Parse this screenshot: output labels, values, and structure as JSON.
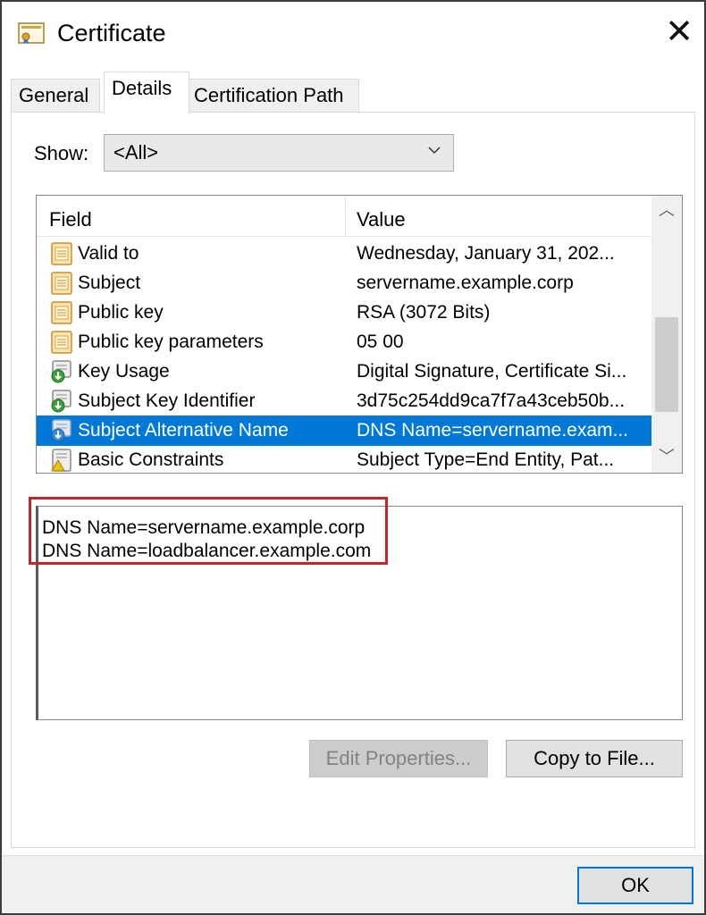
{
  "window": {
    "title": "Certificate",
    "close_glyph": "✕"
  },
  "tabs": [
    {
      "label": "General",
      "active": false
    },
    {
      "label": "Details",
      "active": true
    },
    {
      "label": "Certification Path",
      "active": false
    }
  ],
  "show": {
    "label": "Show:",
    "selected": "<All>"
  },
  "list": {
    "columns": {
      "field": "Field",
      "value": "Value"
    },
    "rows": [
      {
        "field": "Valid to",
        "value": "Wednesday, January 31, 202...",
        "icon": "document-icon",
        "selected": false
      },
      {
        "field": "Subject",
        "value": "servername.example.corp",
        "icon": "document-icon",
        "selected": false
      },
      {
        "field": "Public key",
        "value": "RSA (3072 Bits)",
        "icon": "document-icon",
        "selected": false
      },
      {
        "field": "Public key parameters",
        "value": "05 00",
        "icon": "document-icon",
        "selected": false
      },
      {
        "field": "Key Usage",
        "value": "Digital Signature, Certificate Si...",
        "icon": "extension-icon",
        "selected": false
      },
      {
        "field": "Subject Key Identifier",
        "value": "3d75c254dd9ca7f7a43ceb50b...",
        "icon": "extension-icon",
        "selected": false
      },
      {
        "field": "Subject Alternative Name",
        "value": "DNS Name=servername.exam...",
        "icon": "extension-icon",
        "selected": true
      },
      {
        "field": "Basic Constraints",
        "value": "Subject Type=End Entity, Pat...",
        "icon": "critical-extension-icon",
        "selected": false
      }
    ]
  },
  "detail": {
    "lines": [
      "DNS Name=servername.example.corp",
      "DNS Name=loadbalancer.example.com"
    ]
  },
  "buttons": {
    "edit_properties": "Edit Properties...",
    "copy_to_file": "Copy to File...",
    "ok": "OK"
  },
  "colors": {
    "selection": "#0078d7",
    "highlight_border": "#c0272d"
  }
}
